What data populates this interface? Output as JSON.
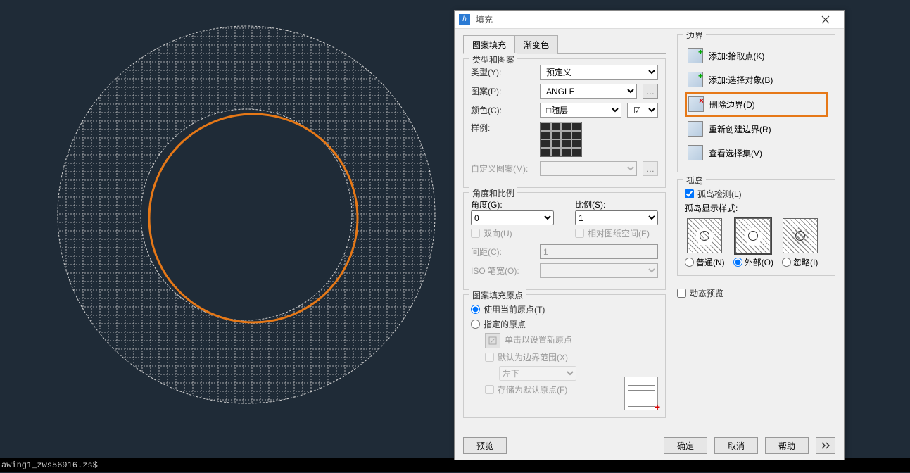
{
  "status_bar": "awing1_zws56916.zs$",
  "dialog": {
    "title": "填充",
    "tabs": {
      "pattern": "图案填充",
      "gradient": "渐变色"
    },
    "type_group": {
      "title": "类型和图案",
      "type_label": "类型(Y):",
      "type_value": "预定义",
      "pattern_label": "图案(P):",
      "pattern_value": "ANGLE",
      "color_label": "颜色(C):",
      "color_value": "随层",
      "sample_label": "样例:",
      "custom_label": "自定义图案(M):"
    },
    "angle_group": {
      "title": "角度和比例",
      "angle_label": "角度(G):",
      "angle_value": "0",
      "scale_label": "比例(S):",
      "scale_value": "1",
      "bidir": "双向(U)",
      "paper_space": "相对图纸空间(E)",
      "spacing_label": "间距(C):",
      "spacing_value": "1",
      "iso_label": "ISO 笔宽(O):"
    },
    "origin_group": {
      "title": "图案填充原点",
      "use_current": "使用当前原点(T)",
      "specified": "指定的原点",
      "click_set": "单击以设置新原点",
      "default_extent": "默认为边界范围(X)",
      "extent_pos": "左下",
      "store_default": "存储为默认原点(F)"
    },
    "boundary": {
      "title": "边界",
      "add_pick": "添加:拾取点(K)",
      "add_select": "添加:选择对象(B)",
      "remove": "删除边界(D)",
      "recreate": "重新创建边界(R)",
      "view_set": "查看选择集(V)"
    },
    "island": {
      "title": "孤岛",
      "detect": "孤岛检测(L)",
      "style_label": "孤岛显示样式:",
      "normal": "普通(N)",
      "outer": "外部(O)",
      "ignore": "忽略(I)"
    },
    "dynamic_preview": "动态预览",
    "footer": {
      "preview": "预览",
      "ok": "确定",
      "cancel": "取消",
      "help": "帮助"
    }
  }
}
